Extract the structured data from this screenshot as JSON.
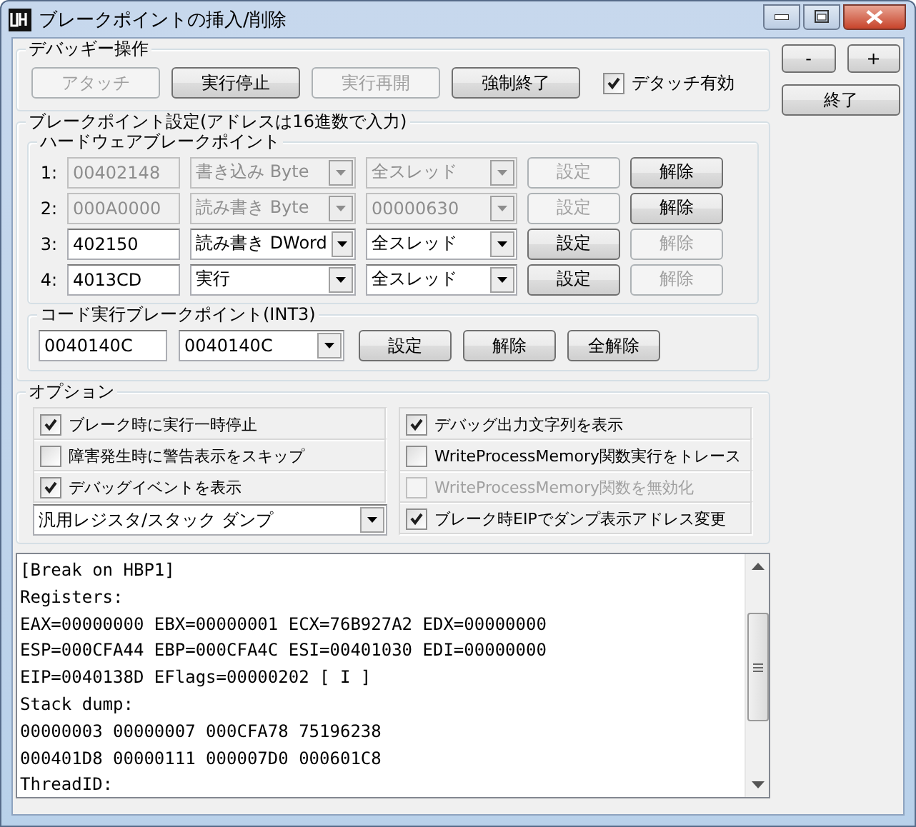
{
  "window": {
    "title": "ブレークポイントの挿入/削除"
  },
  "side_buttons": [
    {
      "label": "-"
    },
    {
      "label": "+"
    },
    {
      "label": "終了"
    }
  ],
  "debuggee": {
    "title": "デバッギー操作",
    "buttons": [
      {
        "label": "アタッチ",
        "disabled": true
      },
      {
        "label": "実行停止",
        "disabled": false
      },
      {
        "label": "実行再開",
        "disabled": true
      },
      {
        "label": "強制終了",
        "disabled": false
      }
    ],
    "detach": {
      "label": "デタッチ有効",
      "checked": true
    }
  },
  "breakpoints": {
    "title": "ブレークポイント設定(アドレスは16進数で入力)",
    "hardware": {
      "title": "ハードウェアブレークポイント",
      "rows": [
        {
          "index": "1:",
          "address": "00402148",
          "type": "書き込み Byte",
          "thread": "全スレッド",
          "disabled": true,
          "set_button": {
            "label": "設定",
            "disabled": true
          },
          "clear_button": {
            "label": "解除",
            "disabled": false
          }
        },
        {
          "index": "2:",
          "address": "000A0000",
          "type": "読み書き Byte",
          "thread": "00000630",
          "disabled": true,
          "set_button": {
            "label": "設定",
            "disabled": true
          },
          "clear_button": {
            "label": "解除",
            "disabled": false
          }
        },
        {
          "index": "3:",
          "address": "402150",
          "type": "読み書き DWord",
          "thread": "全スレッド",
          "disabled": false,
          "set_button": {
            "label": "設定",
            "disabled": false
          },
          "clear_button": {
            "label": "解除",
            "disabled": true
          }
        },
        {
          "index": "4:",
          "address": "4013CD",
          "type": "実行",
          "thread": "全スレッド",
          "disabled": false,
          "set_button": {
            "label": "設定",
            "disabled": false
          },
          "clear_button": {
            "label": "解除",
            "disabled": true
          }
        }
      ]
    },
    "code": {
      "title": "コード実行ブレークポイント(INT3)",
      "address": "0040140C",
      "combo": "0040140C",
      "buttons": [
        {
          "label": "設定"
        },
        {
          "label": "解除"
        },
        {
          "label": "全解除"
        }
      ]
    }
  },
  "options": {
    "title": "オプション",
    "items": [
      {
        "kind": "checkbox",
        "label": "ブレーク時に実行一時停止",
        "checked": true,
        "disabled": false
      },
      {
        "kind": "checkbox",
        "label": "デバッグ出力文字列を表示",
        "checked": true,
        "disabled": false
      },
      {
        "kind": "checkbox",
        "label": "障害発生時に警告表示をスキップ",
        "checked": false,
        "disabled": false
      },
      {
        "kind": "checkbox",
        "label": "WriteProcessMemory関数実行をトレース",
        "checked": false,
        "disabled": false
      },
      {
        "kind": "checkbox",
        "label": "デバッグイベントを表示",
        "checked": true,
        "disabled": false
      },
      {
        "kind": "checkbox",
        "label": "WriteProcessMemory関数を無効化",
        "checked": false,
        "disabled": true
      },
      {
        "kind": "combo",
        "value": "汎用レジスタ/スタック ダンプ"
      },
      {
        "kind": "checkbox",
        "label": "ブレーク時EIPでダンプ表示アドレス変更",
        "checked": true,
        "disabled": false
      }
    ]
  },
  "log": {
    "lines": [
      "[Break on HBP1]",
      "Registers:",
      "EAX=00000000 EBX=00000001 ECX=76B927A2 EDX=00000000",
      "ESP=000CFA44 EBP=000CFA4C ESI=00401030 EDI=00000000",
      "EIP=0040138D EFlags=00000202 [ I ]",
      "Stack dump:",
      "00000003 00000007 000CFA78 75196238",
      "000401D8 00000111 000007D0 000601C8",
      "ThreadID:"
    ]
  }
}
